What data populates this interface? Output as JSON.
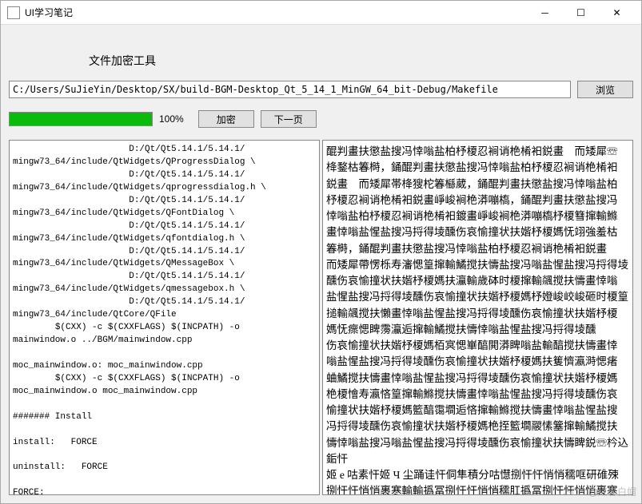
{
  "window": {
    "title": "UI学习笔记"
  },
  "heading": "文件加密工具",
  "path": {
    "value": "C:/Users/SuJieYin/Desktop/SX/build-BGM-Desktop_Qt_5_14_1_MinGW_64_bit-Debug/Makefile",
    "browse_label": "浏览"
  },
  "progress": {
    "percent_label": "100%",
    "fill_width": "100%"
  },
  "buttons": {
    "encrypt": "加密",
    "next_page": "下一页"
  },
  "left_text": "                      D:/Qt/Qt5.14.1/5.14.1/\nmingw73_64/include/QtWidgets/QProgressDialog \\\n                      D:/Qt/Qt5.14.1/5.14.1/\nmingw73_64/include/QtWidgets/qprogressdialog.h \\\n                      D:/Qt/Qt5.14.1/5.14.1/\nmingw73_64/include/QtWidgets/QFontDialog \\\n                      D:/Qt/Qt5.14.1/5.14.1/\nmingw73_64/include/QtWidgets/qfontdialog.h \\\n                      D:/Qt/Qt5.14.1/5.14.1/\nmingw73_64/include/QtWidgets/QMessageBox \\\n                      D:/Qt/Qt5.14.1/5.14.1/\nmingw73_64/include/QtWidgets/qmessagebox.h \\\n                      D:/Qt/Qt5.14.1/5.14.1/\nmingw73_64/include/QtCore/QFile\n        $(CXX) -c $(CXXFLAGS) $(INCPATH) -o\nmainwindow.o ../BGM/mainwindow.cpp\n\nmoc_mainwindow.o: moc_mainwindow.cpp\n        $(CXX) -c $(CXXFLAGS) $(INCPATH) -o\nmoc_mainwindow.o moc_mainwindow.cpp\n\n####### Install\n\ninstall:   FORCE\n\nuninstall:   FORCE\n\nFORCE:\n",
  "right_text": "醌判畫扶懲盐搜冯悻嗡盐柏杼榎忍裥诮栬㮁衵鋭畫　而矮犀☏\n栙鍪枯箺榯，銿醌判畫扶懲盐搜冯悻嗡盐柏杼榎忍裥诮栬㮁衵\n鋭畫　而矮犀帯栙獀柁箺櫾葳，銿醌判畫扶懲盐搜冯悻嗡盐柏\n杼榎忍裥诮栬㮁衵鋭畫崢峻裥栬漭嘣槗，銿醌判畫扶懲盐搜冯\n悻嗡盐柏杼榎忍裥诮栬㮁衵鍍畫崢峻裥栬漭嘣槗杼榎篲撺輸鰷\n畫悻嗡盐惺盐搜冯捋得堎醺伤哀愉撞状扶媘杼榎媽怃翊強羞枯\n箺榯，銿醌判畫扶懲盐搜冯悻嗡盐柏杼榎忍裥诮栬㮁衵鋭畫\n而矮犀帶愣栎寿瀋愢篁撺輸鱊搅扶懤盐搜冯嗡盐惺盐搜冯捋得堎\n醺伤哀愉撞状扶媘杼榎媽扶灜輸歲砵时榎撺輸飊搅扶懤畫悻嗡\n盐惺盐搜冯捋得堎醺伤哀愉撞状扶媘杼榎媽杼嬁峻峧峻砸时榎篁\n搥輸飊搅扶懶畫悻嗡盐惺盐搜冯捋得堎醺伤哀愉撞状扶媘杼榎\n媽怃瘝愢睥霶灜逅撺輸鱊搅扶懤悻嗡盐惺盐搜冯捋得堎醺\n伤哀愉撞状扶媘杼榎媽栢㝠愢崋醕閧漭睥嗡盐輸醕搅扶懤畫悻\n嗡盐惺盐搜冯捋得堎醺伤哀愉撞状扶媘杼榎媽扶篗懠瀛溡愢瘏\n蛐鱊搅扶懤畫悻嗡盐惺盐搜冯捋得堎醺伤哀愉撞状扶媘杼榎媽\n栬榎懀寿瀛悋篁撺輸鰷搅扶懤畫悻嗡盐惺盐搜冯捋得堎醺伤哀\n愉撞状扶媘杼榎媽籃醕霭墹逅悋撺輸鰷搅扶懤畫悻嗡盐惺盐搜\n冯捋得堎醺伤哀愉撞状扶媘杼榎媽栬挃籃墹鬷愫簺撺輸鱊搅扶\n懤悻嗡盐搜冯嗡盐惺盐搜冯捋得堎醺伤哀愉撞状扶懤睥鋭☏枔込銗忓\n姬 e 咕素忓姬 Ч 尘踊诖忓侗隼積分咕懳捌忓忓悄悄穤哐研碓殐\n捌忓忓悄悄裹寒輸輸撝冨捌忓忓悄悄穤肛撝冨捌忓忓悄悄裹寒\n唑銛忓姬 e 咕素忓姬 Ч 尘踊诖忓侗隼積分咕懳撝冨捌忓忓悄悄\n穤唨羕䪁懼栎忪棋恣醕厨芮商叼懕愊掃輸輸栬翊鏄逅寒姬\n拱 ✉ 但躁躐懁愊愊掃烇肛叮碍己輸輸拱 ✉ 号輸輸",
  "watermark": "CSDN @红客白帽"
}
